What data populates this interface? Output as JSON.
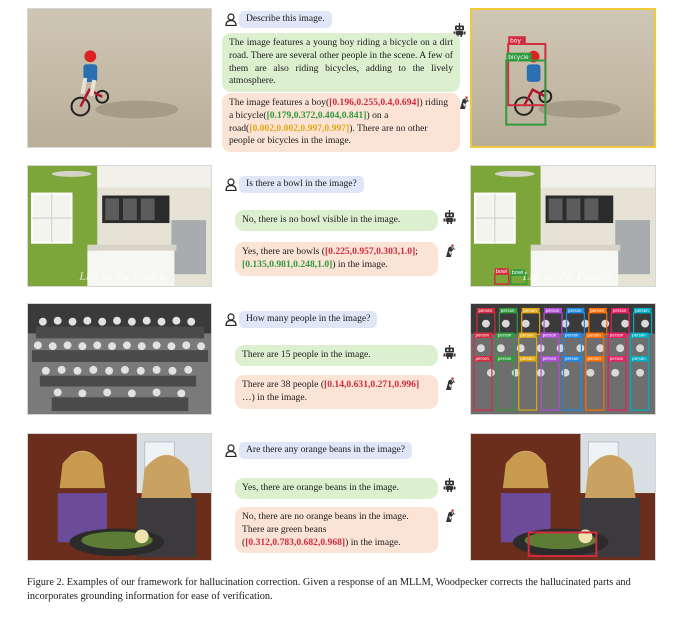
{
  "rows": [
    {
      "question": "Describe this image.",
      "answer": "The image features a young boy riding a bicycle on a dirt road. There are several other people in the scene. A few of them are also riding bicycles, adding to the lively atmosphere.",
      "corr": {
        "p1": "The image features a boy(",
        "b1": "[0.196,0.255,0.4,0.694]",
        "p2": ") riding a bicycle(",
        "b2": "[0.179,0.372,0.404,0.841]",
        "p3": ") on a road(",
        "b3": "[0.002,0.002,0.997,0.997]",
        "p4": "). There are no other people or bicycles in the image."
      },
      "det_labels": [
        "boy",
        "bicycle"
      ]
    },
    {
      "question": "Is there a bowl in the image?",
      "answer": "No, there is no bowl visible in the image.",
      "corr": {
        "p1": "Yes, there are bowls (",
        "b1": "[0.225,0.957,0.303,1.0]",
        "p2": "; ",
        "b2": "[0.135,0.981,0.248,1.0]",
        "p3": ") in the image."
      },
      "watermark": "Life on the Prairie",
      "det_labels": [
        "bowl",
        "bowl"
      ]
    },
    {
      "question": "How many people in the image?",
      "answer": "There are 15 people in the image.",
      "corr": {
        "p1": "There are 38 people (",
        "b1": "[0.14,0.631,0.271,0.996]",
        "p2": " …) in the image."
      },
      "det_label": "person"
    },
    {
      "question": "Are there any orange beans in the image?",
      "answer": "Yes, there are orange beans in the image.",
      "corr": {
        "p1": "No, there are no orange beans in the image. There are green beans (",
        "b1": "[0.312,0.783,0.682,0.968]",
        "p2": ") in the image."
      }
    }
  ],
  "caption": "Figure 2. Examples of our framework for hallucination correction. Given a response of an MLLM, Woodpecker corrects the hallucinated parts and incorporates grounding information for ease of verification.",
  "colors": {
    "question_bg": "#dfe6f7",
    "answer_bg": "#dcf0cf",
    "corrected_bg": "#fbe3d6",
    "bbox_red": "#d12b3e",
    "bbox_green": "#2f9a3e",
    "bbox_yellow": "#e0a814",
    "highlight_border": "#f0c93a"
  },
  "icons": {
    "user": "person-outline-icon",
    "model": "robot-icon",
    "corrector": "woodpecker-icon"
  }
}
